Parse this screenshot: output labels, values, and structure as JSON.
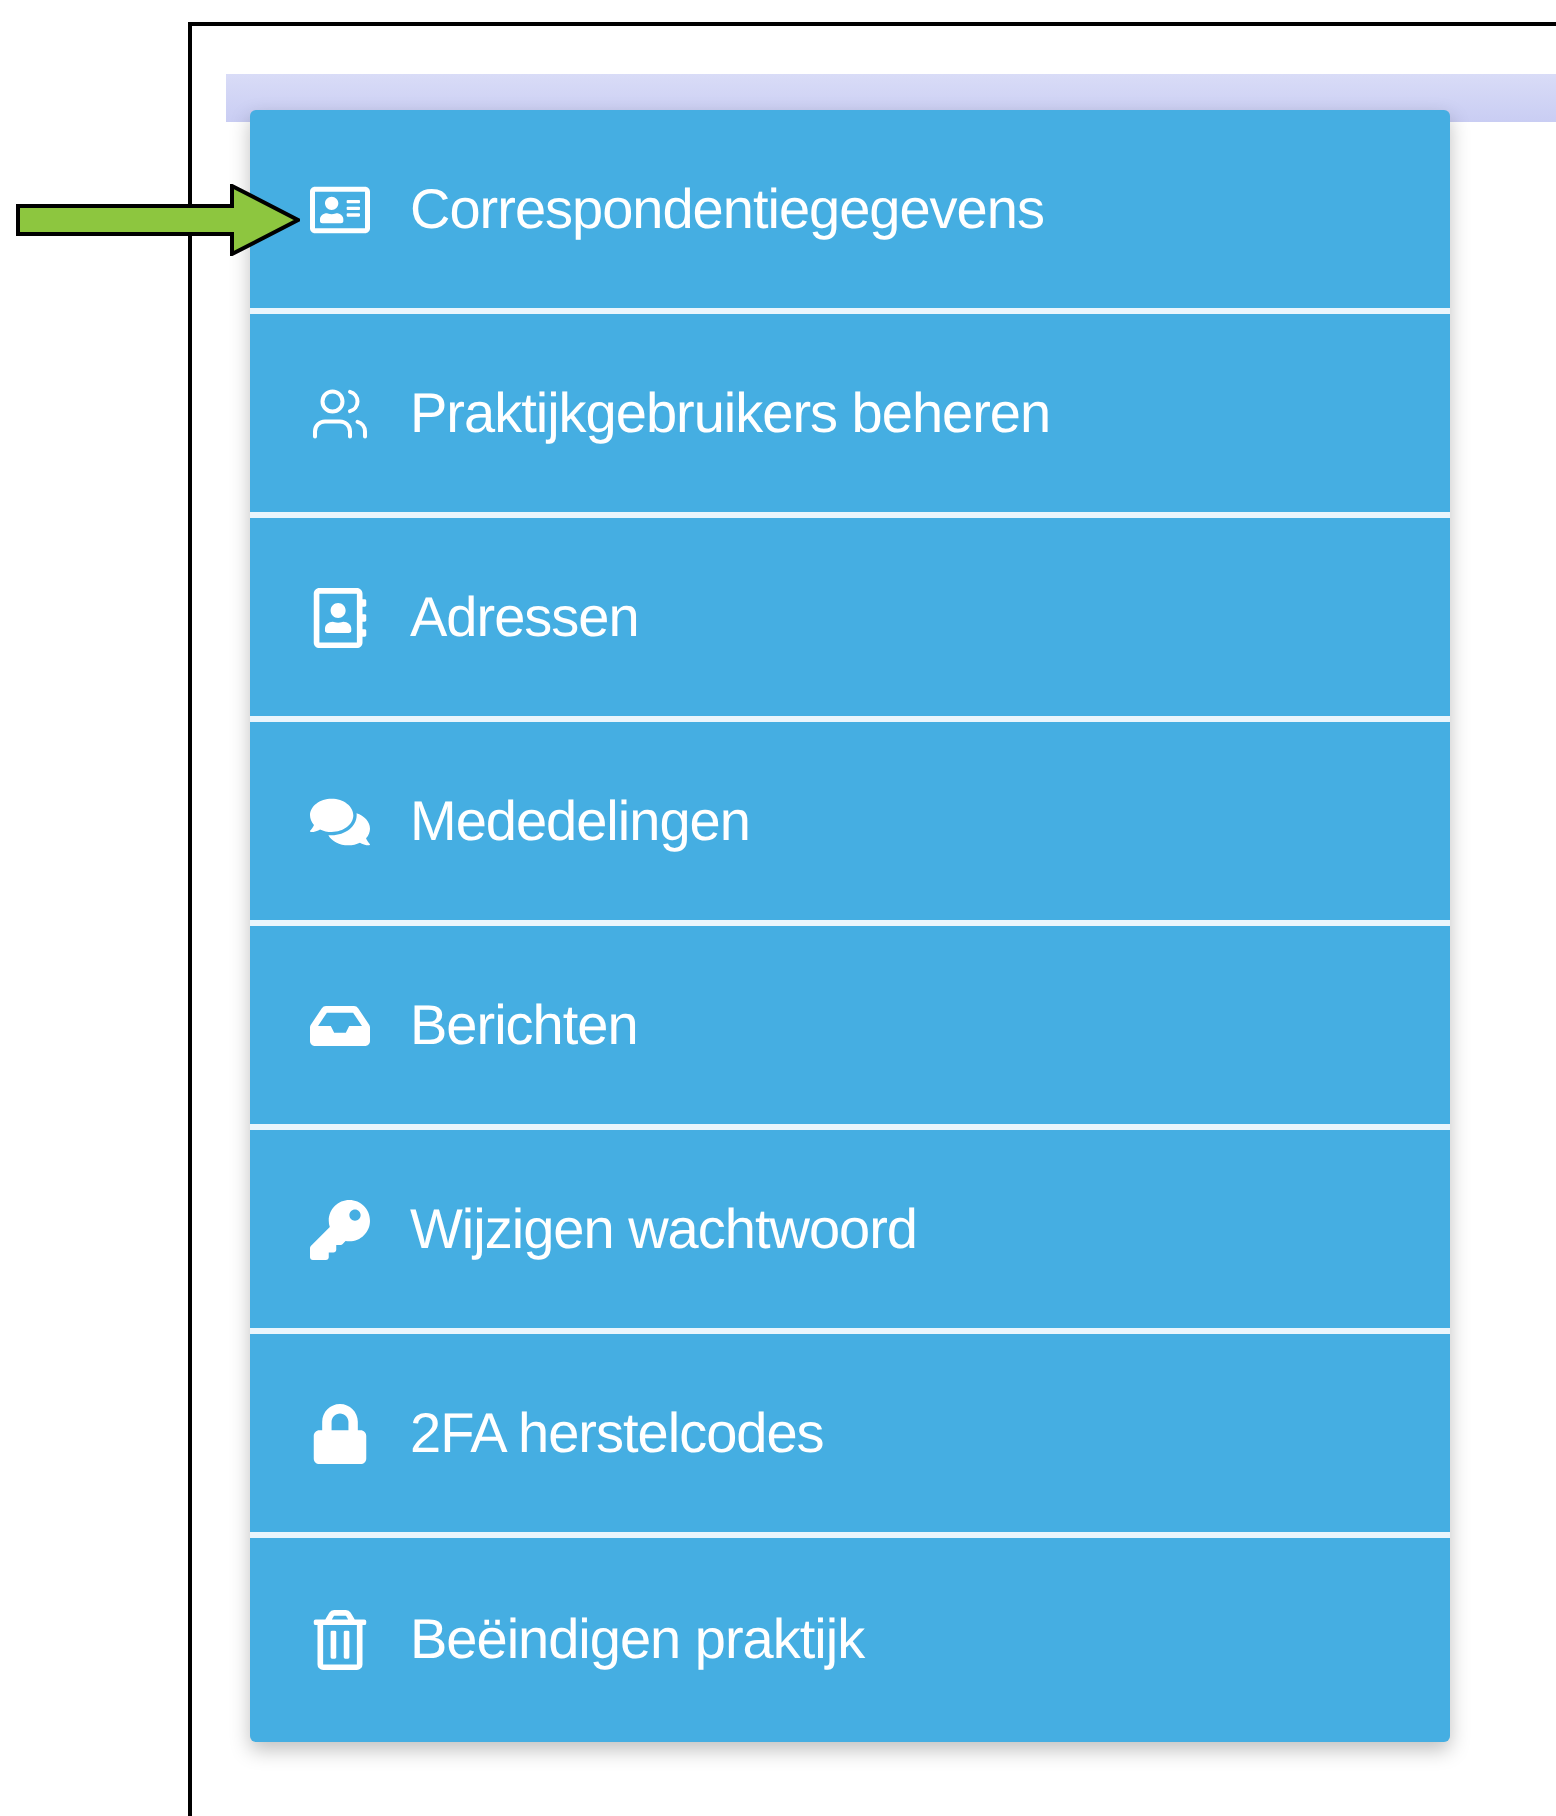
{
  "menu": {
    "items": [
      {
        "label": "Correspondentiegegevens"
      },
      {
        "label": "Praktijkgebruikers beheren"
      },
      {
        "label": "Adressen"
      },
      {
        "label": "Mededelingen"
      },
      {
        "label": "Berichten"
      },
      {
        "label": "Wijzigen wachtwoord"
      },
      {
        "label": "2FA herstelcodes"
      },
      {
        "label": "Beëindigen praktijk"
      }
    ]
  }
}
